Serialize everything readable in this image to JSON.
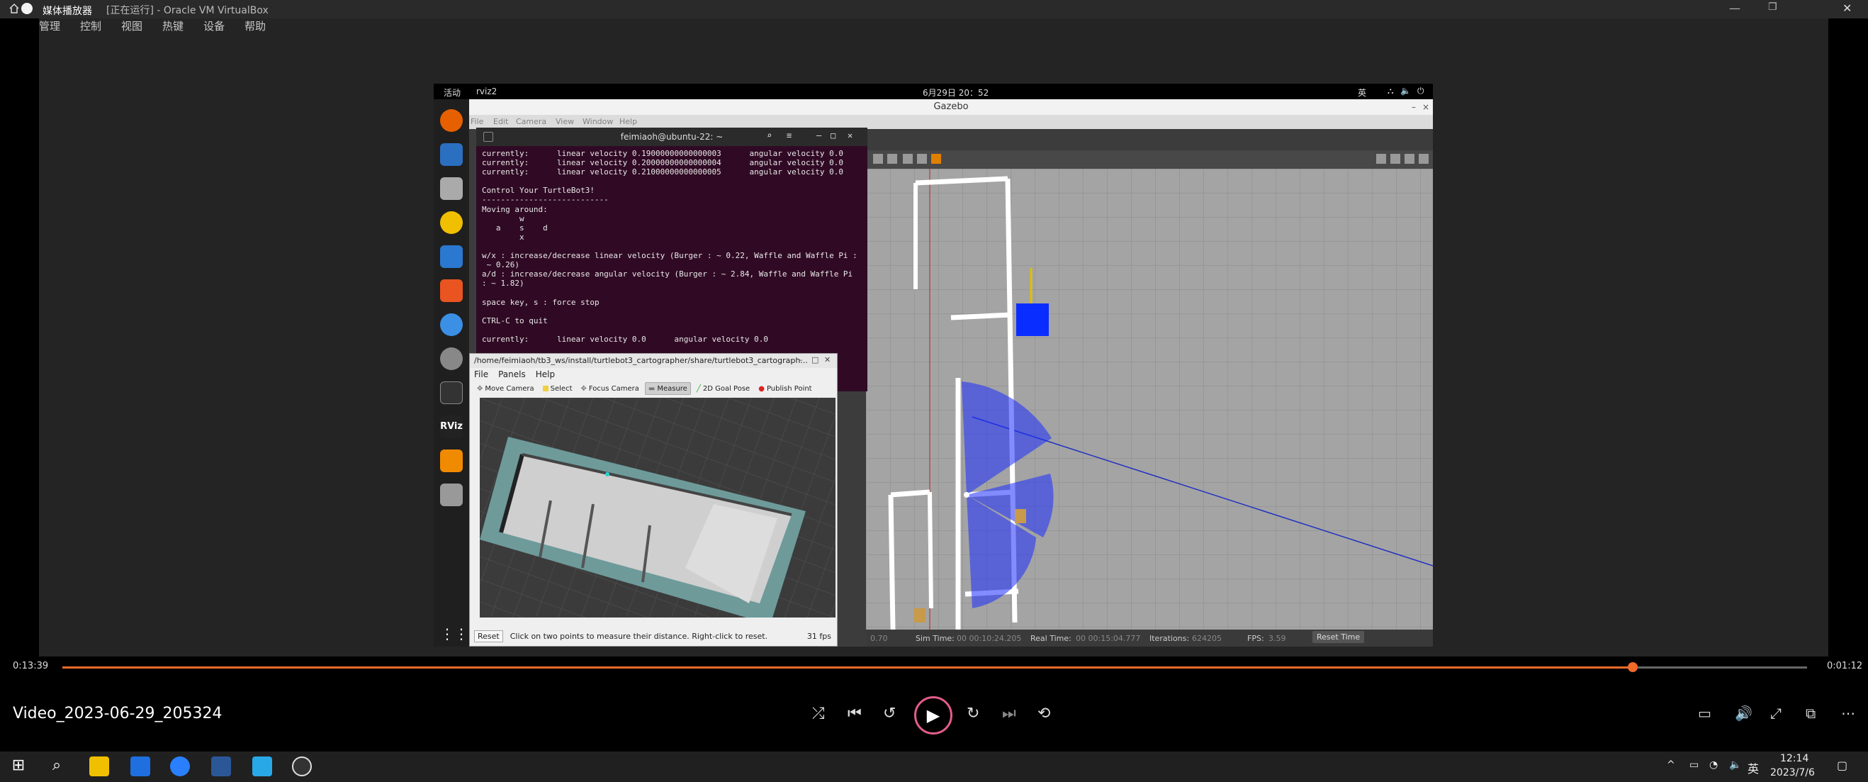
{
  "player": {
    "app_title": "媒体播放器",
    "video_title": "Video_2023-06-29_205324",
    "elapsed": "0:13:39",
    "remaining": "0:01:12",
    "progress_fraction": 0.9
  },
  "vbox": {
    "window_title": "[正在运行] - Oracle VM VirtualBox",
    "menu": [
      "管理",
      "控制",
      "视图",
      "热键",
      "设备",
      "帮助"
    ]
  },
  "ubuntu": {
    "activities": "活动",
    "app_indicator": "rviz2",
    "clock": "6月29日 20：52",
    "ime": "英"
  },
  "gazebo": {
    "title": "Gazebo",
    "menu": [
      "File",
      "Edit",
      "Camera",
      "View",
      "Window",
      "Help"
    ],
    "status": {
      "rtf_value": "0.70",
      "sim_time_label": "Sim Time:",
      "sim_time": "00 00:10:24.205",
      "real_time_label": "Real Time:",
      "real_time": "00 00:15:04.777",
      "iterations_label": "Iterations:",
      "iterations": "624205",
      "fps_label": "FPS:",
      "fps": "3.59",
      "reset_time": "Reset Time"
    }
  },
  "terminal": {
    "title": "feimiaoh@ubuntu-22: ~",
    "lines": [
      "currently:      linear velocity 0.19000000000000003      angular velocity 0.0",
      "currently:      linear velocity 0.20000000000000004      angular velocity 0.0",
      "currently:      linear velocity 0.21000000000000005      angular velocity 0.0",
      "",
      "Control Your TurtleBot3!",
      "---------------------------",
      "Moving around:",
      "        w",
      "   a    s    d",
      "        x",
      "",
      "w/x : increase/decrease linear velocity (Burger : ~ 0.22, Waffle and Waffle Pi :",
      " ~ 0.26)",
      "a/d : increase/decrease angular velocity (Burger : ~ 2.84, Waffle and Waffle Pi",
      ": ~ 1.82)",
      "",
      "space key, s : force stop",
      "",
      "CTRL-C to quit",
      "",
      "currently:      linear velocity 0.0      angular velocity 0.0"
    ]
  },
  "rviz": {
    "title": "/home/feimiaoh/tb3_ws/install/turtlebot3_cartographer/share/turtlebot3_cartograph...",
    "menu": [
      "File",
      "Panels",
      "Help"
    ],
    "tools": [
      "Move Camera",
      "Select",
      "Focus Camera",
      "Measure",
      "2D Goal Pose",
      "Publish Point"
    ],
    "reset": "Reset",
    "status_text": "Click on two points to measure their distance. Right-click to reset.",
    "fps": "31 fps"
  },
  "taskbar": {
    "ime": "英",
    "time": "12:14",
    "date": "2023/7/6"
  }
}
